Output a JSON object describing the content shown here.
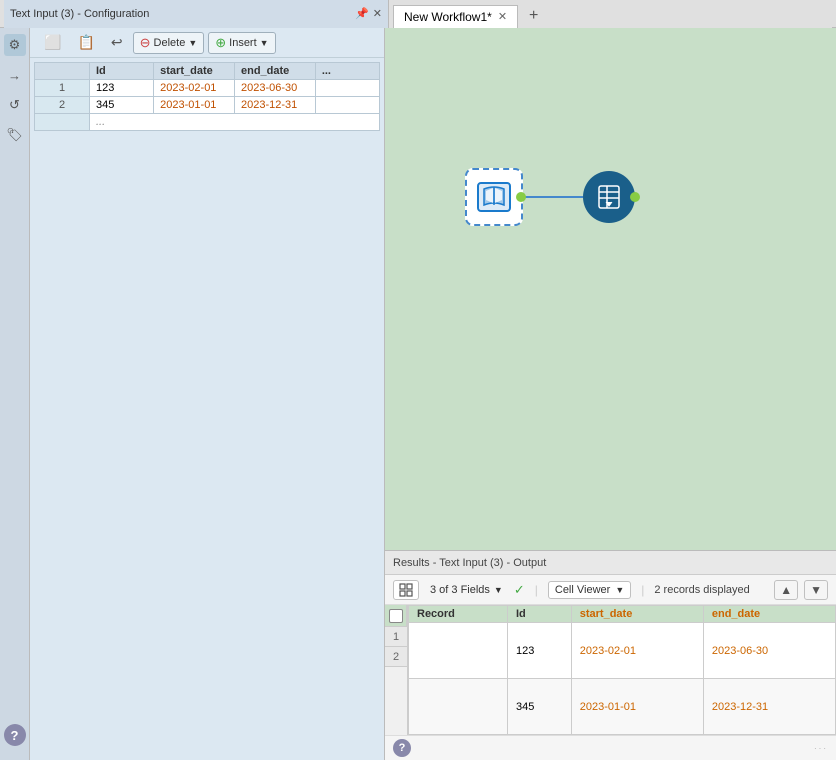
{
  "tabs": [
    {
      "id": "workflow1",
      "label": "New Workflow1*",
      "active": true
    },
    {
      "id": "add",
      "label": "+",
      "isAdd": true
    }
  ],
  "left_panel": {
    "title": "Text Input (3) - Configuration",
    "toolbar": {
      "delete_label": "Delete",
      "insert_label": "Insert"
    },
    "table": {
      "columns": [
        "Id",
        "start_date",
        "end_date",
        "..."
      ],
      "rows": [
        {
          "rowNum": 1,
          "id": "123",
          "start_date": "2023-02-01",
          "end_date": "2023-06-30"
        },
        {
          "rowNum": 2,
          "id": "345",
          "start_date": "2023-01-01",
          "end_date": "2023-12-31"
        }
      ],
      "more_row": "..."
    }
  },
  "sidebar": {
    "icons": [
      {
        "name": "settings-icon",
        "symbol": "⚙",
        "active": true
      },
      {
        "name": "arrow-icon",
        "symbol": "→"
      },
      {
        "name": "refresh-icon",
        "symbol": "↺"
      },
      {
        "name": "tag-icon",
        "symbol": "🏷"
      },
      {
        "name": "help-icon",
        "symbol": "?"
      }
    ]
  },
  "canvas": {
    "nodes": [
      {
        "id": "text-input",
        "type": "text-input",
        "label": "Text Input"
      },
      {
        "id": "select",
        "type": "select",
        "label": "Select"
      }
    ]
  },
  "results_panel": {
    "header": "Results - Text Input (3) - Output",
    "fields_label": "3 of 3 Fields",
    "checkmark_symbol": "✓",
    "cell_viewer_label": "Cell Viewer",
    "records_displayed": "2 records displayed",
    "table": {
      "columns": [
        "Record",
        "Id",
        "start_date",
        "end_date"
      ],
      "rows": [
        {
          "rowNum": 1,
          "record": "",
          "id": "123",
          "start_date": "2023-02-01",
          "end_date": "2023-06-30"
        },
        {
          "rowNum": 2,
          "record": "",
          "id": "345",
          "start_date": "2023-01-01",
          "end_date": "2023-12-31"
        }
      ]
    }
  }
}
